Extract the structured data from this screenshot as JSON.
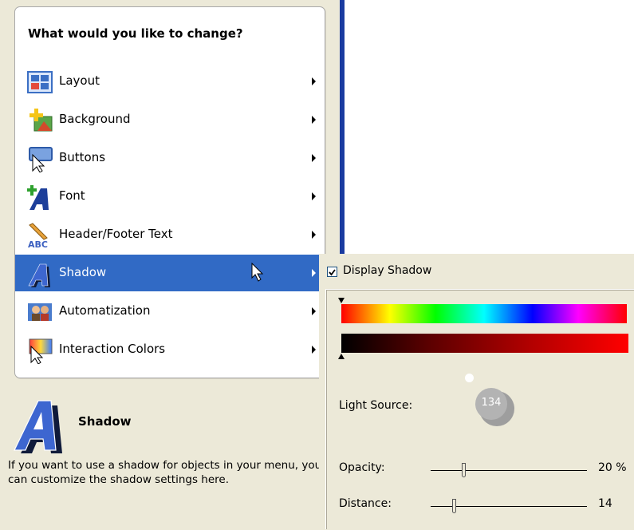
{
  "menu": {
    "title": "What would you like to change?",
    "items": [
      {
        "label": "Layout",
        "icon": "layout-grid-icon"
      },
      {
        "label": "Background",
        "icon": "background-picture-icon"
      },
      {
        "label": "Buttons",
        "icon": "button-cursor-icon"
      },
      {
        "label": "Font",
        "icon": "font-plus-icon"
      },
      {
        "label": "Header/Footer Text",
        "icon": "abc-pencil-icon"
      },
      {
        "label": "Shadow",
        "icon": "shadow-letter-icon",
        "selected": true
      },
      {
        "label": "Automatization",
        "icon": "automatization-people-icon"
      },
      {
        "label": "Interaction Colors",
        "icon": "interaction-colors-icon"
      }
    ]
  },
  "description": {
    "title": "Shadow",
    "text": "If you want to use a shadow for objects in your menu, you can customize the shadow settings here."
  },
  "shadow_panel": {
    "display_shadow_label": "Display Shadow",
    "display_shadow_checked": true,
    "light_source_label": "Light Source:",
    "light_source_value": "134",
    "opacity_label": "Opacity:",
    "opacity_value": "20 %",
    "opacity_fraction": 0.2,
    "distance_label": "Distance:",
    "distance_value": "14",
    "distance_fraction": 0.14
  },
  "colors": {
    "selection": "#316ac5",
    "accent_bar": "#1a3ba0",
    "panel_bg": "#ece9d8"
  }
}
